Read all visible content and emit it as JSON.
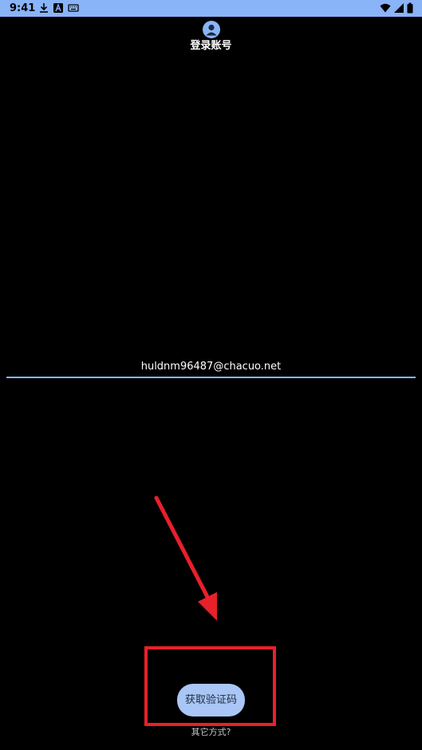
{
  "status_bar": {
    "time": "9:41",
    "left_icons": [
      "download-icon",
      "font-a-icon",
      "keyboard-icon"
    ],
    "right_icons": [
      "wifi-icon",
      "signal-icon",
      "battery-icon"
    ],
    "background_color": "#8ab4f8"
  },
  "header": {
    "avatar_icon": "person-icon",
    "title": "登录账号"
  },
  "email": {
    "value": "huldnm96487@chacuo.net",
    "underline_color": "#8ab4f8"
  },
  "primary_action": {
    "label": "获取验证码",
    "color": "#a9c6f7"
  },
  "secondary_action": {
    "label": "其它方式?"
  },
  "annotation": {
    "color": "#e8202a",
    "shapes": [
      "arrow",
      "rectangle"
    ]
  }
}
